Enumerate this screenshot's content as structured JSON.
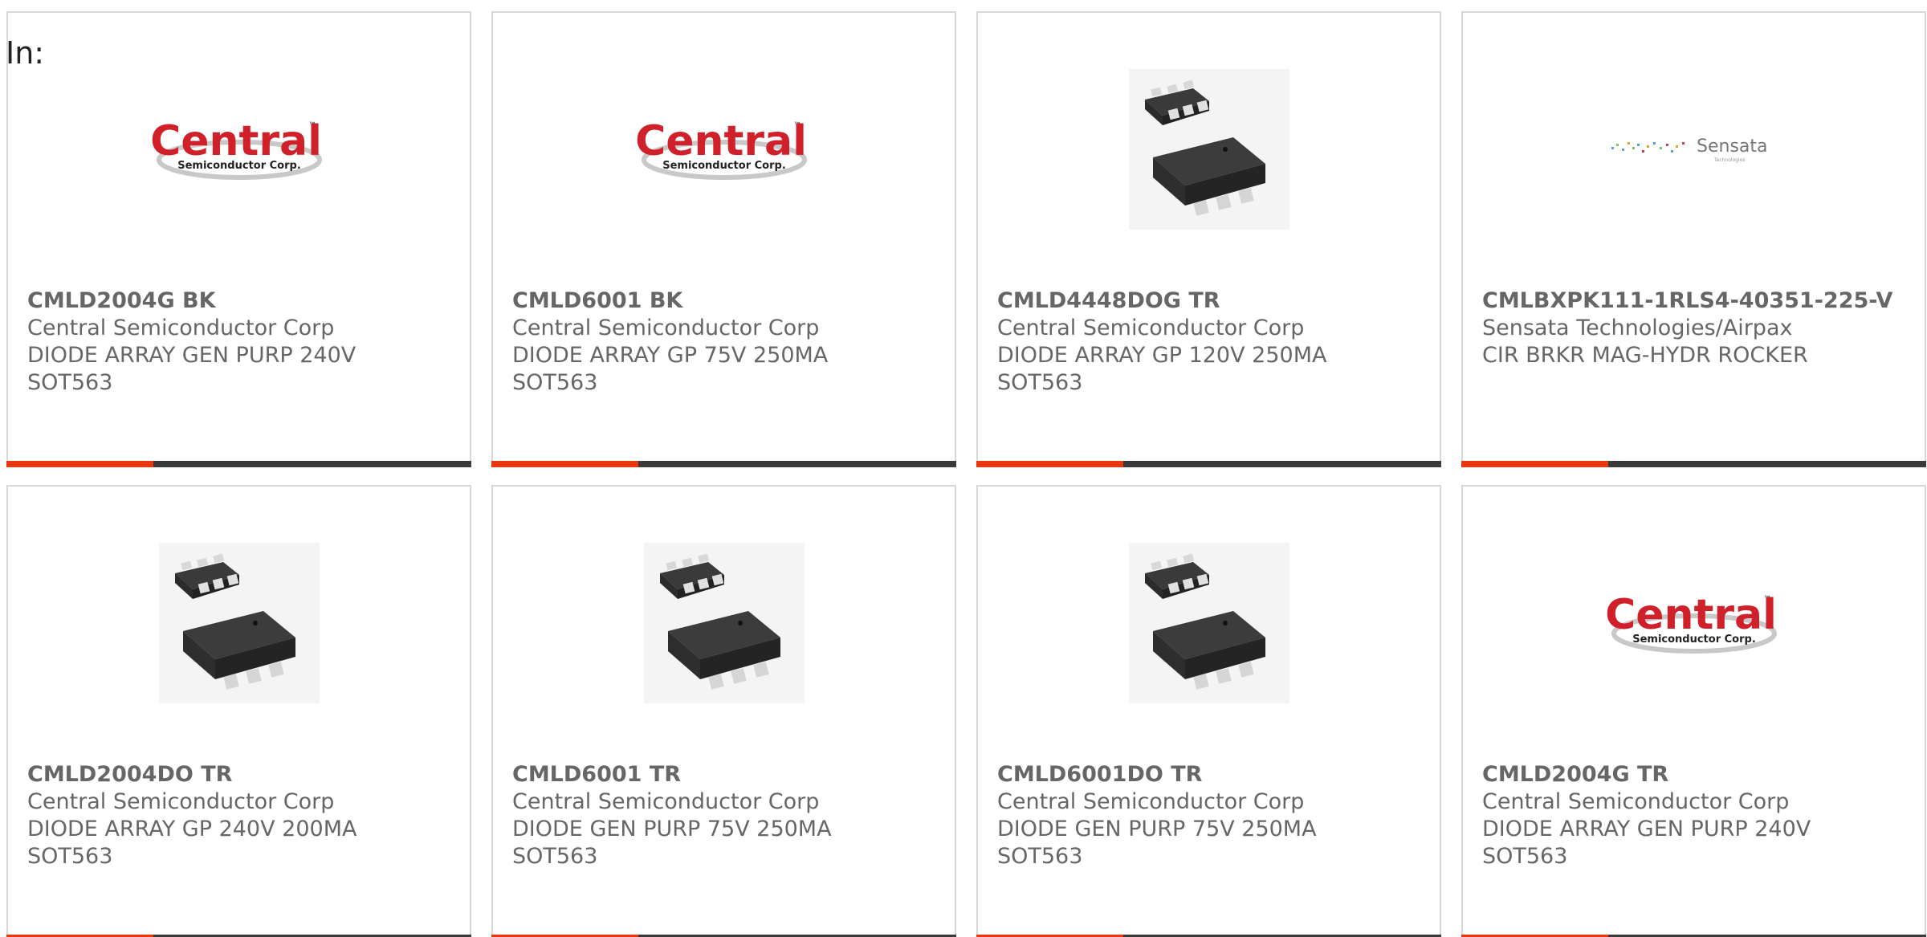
{
  "in_label": "In:",
  "colors": {
    "accent": "#e8380d",
    "bar_dark": "#3a3a3a",
    "text_gray": "#666666",
    "card_border": "#d8d8d8"
  },
  "products": [
    {
      "image": "central-logo",
      "part_number": "CMLD2004G BK",
      "manufacturer": "Central Semiconductor Corp",
      "description": "DIODE ARRAY GEN PURP 240V",
      "package": "SOT563"
    },
    {
      "image": "central-logo",
      "part_number": "CMLD6001 BK",
      "manufacturer": "Central Semiconductor Corp",
      "description": "DIODE ARRAY GP 75V 250MA",
      "package": "SOT563"
    },
    {
      "image": "sot563-package",
      "part_number": "CMLD4448DOG TR",
      "manufacturer": "Central Semiconductor Corp",
      "description": "DIODE ARRAY GP 120V 250MA",
      "package": "SOT563"
    },
    {
      "image": "sensata-logo",
      "part_number": "CMLBXPK111-1RLS4-40351-225-V",
      "manufacturer": "Sensata Technologies/Airpax",
      "description": "CIR BRKR MAG-HYDR ROCKER",
      "package": ""
    },
    {
      "image": "sot563-package",
      "part_number": "CMLD2004DO TR",
      "manufacturer": "Central Semiconductor Corp",
      "description": "DIODE ARRAY GP 240V 200MA",
      "package": "SOT563"
    },
    {
      "image": "sot563-package",
      "part_number": "CMLD6001 TR",
      "manufacturer": "Central Semiconductor Corp",
      "description": "DIODE GEN PURP 75V 250MA",
      "package": "SOT563"
    },
    {
      "image": "sot563-package",
      "part_number": "CMLD6001DO TR",
      "manufacturer": "Central Semiconductor Corp",
      "description": "DIODE GEN PURP 75V 250MA",
      "package": "SOT563"
    },
    {
      "image": "central-logo",
      "part_number": "CMLD2004G TR",
      "manufacturer": "Central Semiconductor Corp",
      "description": "DIODE ARRAY GEN PURP 240V",
      "package": "SOT563"
    }
  ],
  "logos": {
    "central_word": "Central",
    "central_tm": "™",
    "central_sub": "Semiconductor Corp.",
    "sensata_word": "Sensata",
    "sensata_sub": "Technologies"
  }
}
